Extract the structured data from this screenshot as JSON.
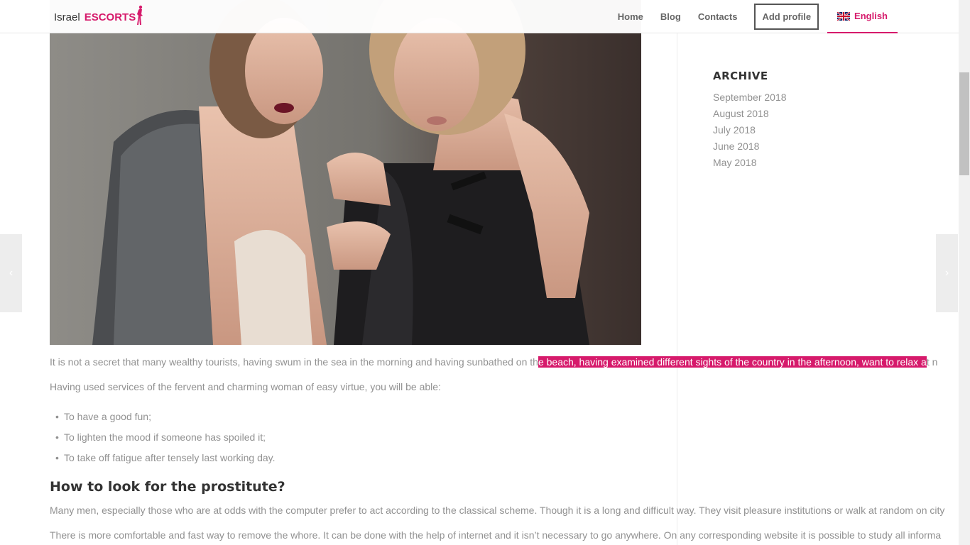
{
  "header": {
    "logo_part1": "Israel",
    "logo_part2": "ESCORTS",
    "nav": {
      "home": "Home",
      "blog": "Blog",
      "contacts": "Contacts",
      "add_profile": "Add profile",
      "language": "English"
    }
  },
  "hero_image": {
    "alt": "two-women-photo"
  },
  "sidebar": {
    "archive_title": "ARCHIVE",
    "archive_items": [
      "September 2018",
      "August 2018",
      "July 2018",
      "June 2018",
      "May 2018"
    ]
  },
  "article": {
    "p1_before": "It is not a secret that many wealthy tourists, having swum in the sea in the morning and having sunbathed on th",
    "p1_highlight": "e beach, having examined different sights of the country in the afternoon, want to relax a",
    "p1_after": "t n",
    "p2": "Having used services of the fervent and charming woman of easy virtue, you will be able:",
    "list": [
      "To have a good fun;",
      "To lighten the mood if someone has spoiled it;",
      "To take off fatigue after tensely last working day."
    ],
    "heading": "How to look for the prostitute?",
    "p3": "Many men, especially those who are at odds with the computer prefer to act according to the classical scheme. Though it is a long and difficult way. They visit pleasure institutions or walk at random on city",
    "p4": "There is more comfortable and fast way to remove the whore. It can be done with the help of internet and it isn’t necessary to go anywhere. On any corresponding website it is possible to study all informa"
  },
  "colors": {
    "accent": "#d61a6b",
    "text": "#919191",
    "heading": "#333333"
  },
  "icons": {
    "prev": "chevron-left-icon",
    "next": "chevron-right-icon",
    "flag": "uk-flag-icon",
    "logo_figure": "woman-silhouette-icon"
  }
}
